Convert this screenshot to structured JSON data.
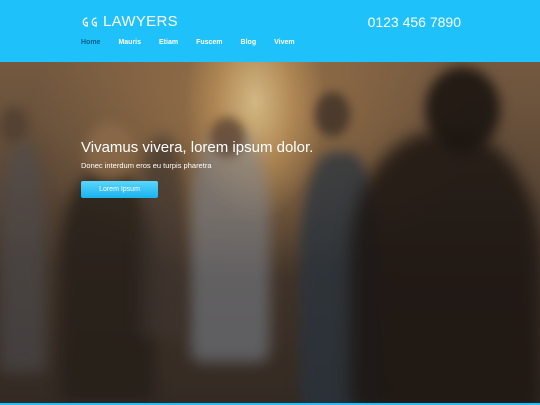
{
  "brand": {
    "name": "LAWYERS",
    "logo_icon": "gg-monogram-icon",
    "accent_color": "#1fc1fb"
  },
  "header": {
    "phone": "0123 456 7890"
  },
  "nav": {
    "items": [
      {
        "label": "Home",
        "active": true
      },
      {
        "label": "Mauris",
        "active": false
      },
      {
        "label": "Etiam",
        "active": false
      },
      {
        "label": "Fuscem",
        "active": false
      },
      {
        "label": "Blog",
        "active": false
      },
      {
        "label": "Vivem",
        "active": false
      }
    ]
  },
  "hero": {
    "title": "Vivamus vivera, lorem ipsum dolor.",
    "subtitle": "Donec interdum eros eu turpis pharetra",
    "button_label": "Lorem Ipsum"
  }
}
